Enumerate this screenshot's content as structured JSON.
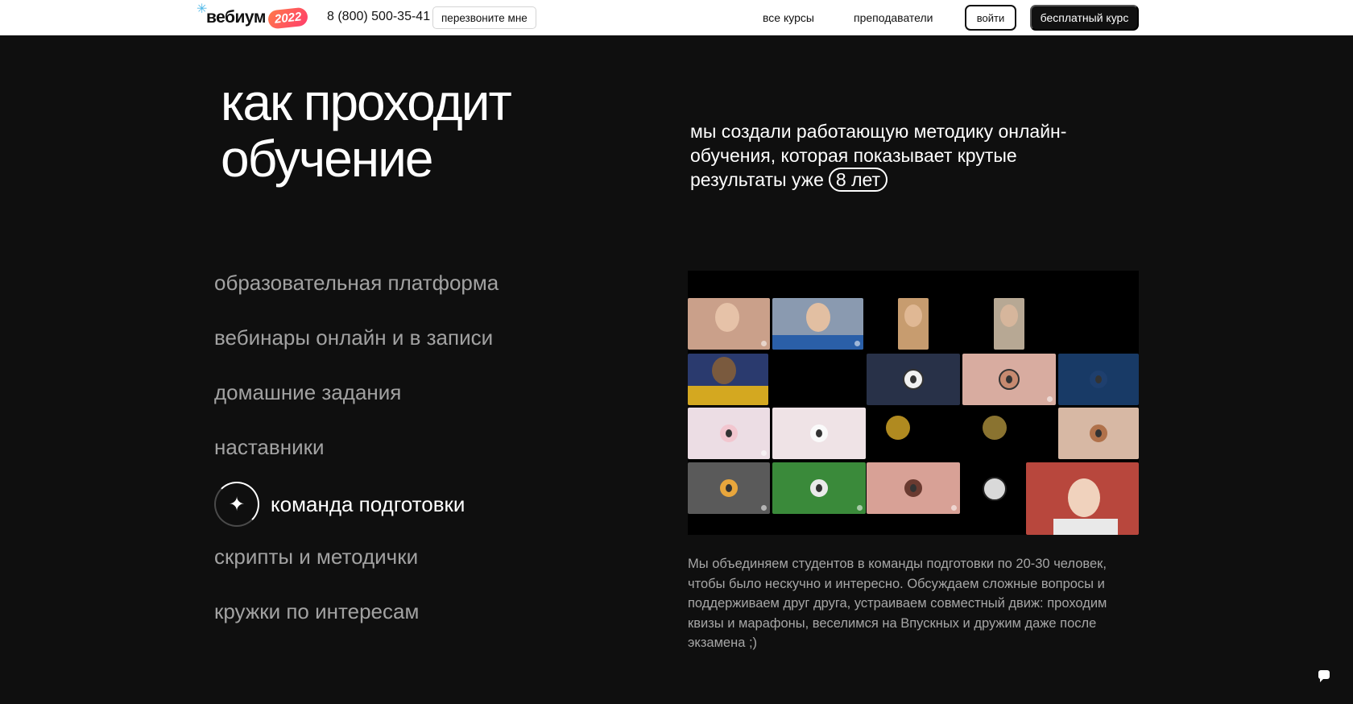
{
  "header": {
    "logo_text": "вебиум",
    "logo_year": "2022",
    "phone": "8 (800) 500-35-41",
    "callback_label": "перезвоните мне",
    "nav": [
      "все курсы",
      "преподаватели"
    ],
    "login_label": "войти",
    "free_course_label": "бесплатный курс"
  },
  "main": {
    "title_line1": "как проходит",
    "title_line2": "обучение",
    "intro_text": "мы создали работающую методику онлайн-обучения, которая показывает крутые результаты уже",
    "intro_badge": "8 лет",
    "menu": [
      "образовательная платформа",
      "вебинары онлайн и в записи",
      "домашние задания",
      "наставники",
      "команда подготовки",
      "скрипты и методички",
      "кружки по интересам"
    ],
    "active_menu_index": 4,
    "description": "Мы объединяем студентов в команды подготовки по 20-30 человек, чтобы было нескучно и интересно. Обсуждаем сложные вопросы и поддерживаем друг друга, устраиваем совместный движ: проходим квизы и марафоны, веселимся на Впускных и дружим даже после экзамена ;)"
  },
  "colors": {
    "page_bg": "#0f0f0f",
    "header_bg": "#ffffff",
    "inactive_menu": "#a2a2a2",
    "logo_accent": "#ff4f5e"
  },
  "icons": {
    "active_item": "sparkle-icon",
    "chat": "chat-bubble-icon",
    "logo": "snowflake-icon"
  }
}
